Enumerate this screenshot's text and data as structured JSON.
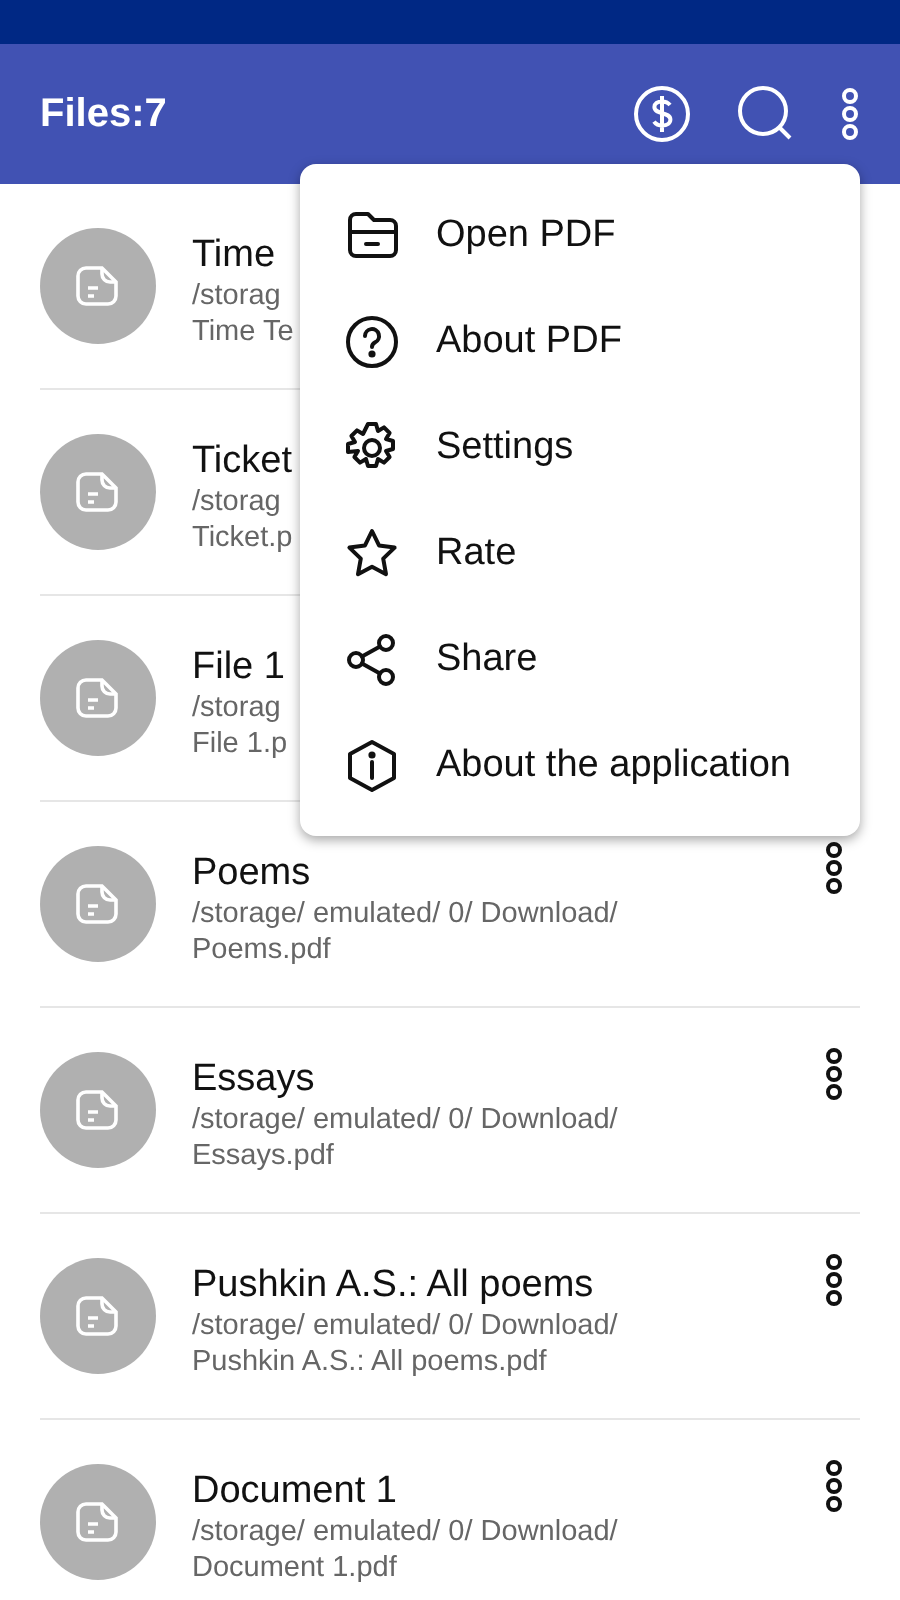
{
  "app_bar": {
    "title": "Files:7"
  },
  "files": [
    {
      "kind": "covered",
      "name": "Time",
      "path": "/storag",
      "file": "Time Te"
    },
    {
      "kind": "covered",
      "name": "Ticket",
      "path": "/storag",
      "file": "Ticket.p"
    },
    {
      "kind": "covered",
      "name": "File 1",
      "path": "/storag",
      "file": "File 1.p"
    },
    {
      "kind": "full",
      "name": "Poems",
      "path": "/storage/ emulated/ 0/ Download/",
      "file": "Poems.pdf"
    },
    {
      "kind": "full",
      "name": "Essays",
      "path": "/storage/ emulated/ 0/ Download/",
      "file": "Essays.pdf"
    },
    {
      "kind": "full",
      "name": "Pushkin A.S.: All poems",
      "path": "/storage/ emulated/ 0/ Download/",
      "file": "Pushkin A.S.: All poems.pdf"
    },
    {
      "kind": "full",
      "name": "Document 1",
      "path": "/storage/ emulated/ 0/ Download/",
      "file": "Document 1.pdf"
    }
  ],
  "menu": [
    {
      "label": "Open PDF",
      "kind": "folder"
    },
    {
      "label": "About PDF",
      "kind": "question"
    },
    {
      "label": "Settings",
      "kind": "gear"
    },
    {
      "label": "Rate",
      "kind": "star"
    },
    {
      "label": "Share",
      "kind": "share"
    },
    {
      "label": "About the application",
      "kind": "info"
    }
  ]
}
